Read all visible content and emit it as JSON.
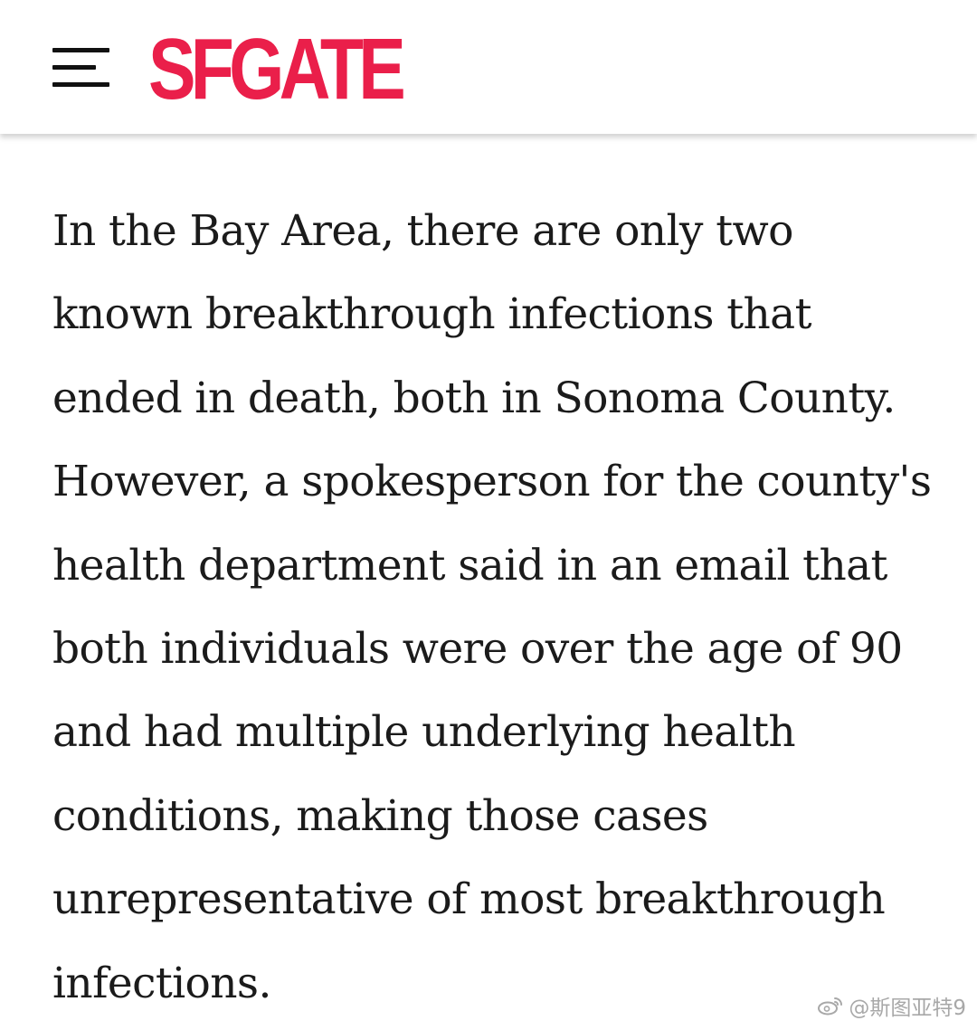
{
  "header": {
    "menu_icon": "hamburger-menu-icon",
    "logo_text": "SFGATE",
    "brand_color": "#ea1f4a"
  },
  "article": {
    "paragraph": "In the Bay Area, there are only two known breakthrough infections that ended in death, both in Sonoma County. However, a spokesperson for the county's health department said in an email that both individuals were over the age of 90 and had multiple underlying health conditions, making those cases unrepresentative of most breakthrough infections."
  },
  "watermark": {
    "icon": "weibo-icon",
    "text": "@斯图亚特9"
  }
}
